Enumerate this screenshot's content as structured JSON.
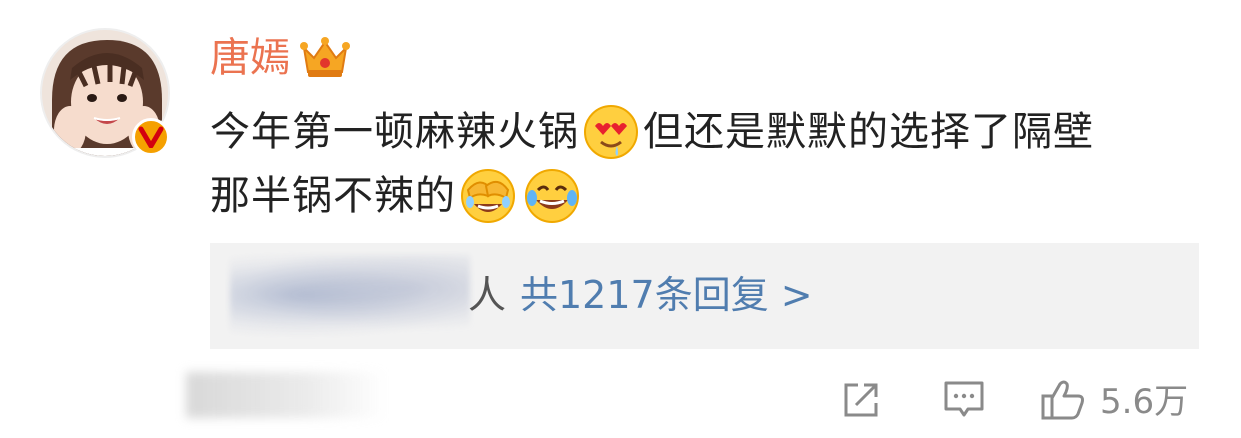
{
  "post": {
    "username": "唐嫣",
    "content": {
      "line1_text_a": "今年第一顿麻辣火锅",
      "line1_text_b": "但还是默默的选择了隔壁",
      "line2_text": "那半锅不辣的"
    },
    "emojis": [
      "heart-eyes-drool-emoji",
      "facepalm-laugh-emoji",
      "tears-of-joy-emoji"
    ]
  },
  "replies": {
    "people_suffix": "人",
    "link_text": "共1217条回复 >"
  },
  "actions": {
    "like_count": "5.6万"
  },
  "icons": {
    "verified": "verified-v-icon",
    "crown": "crown-badge-icon",
    "repost": "repost-icon",
    "comment": "comment-icon",
    "like": "thumbs-up-icon"
  },
  "colors": {
    "username": "#eb7350",
    "link": "#507daf",
    "verified": "#f5a000",
    "reply_bg": "#f2f2f2",
    "icon_gray": "#8a8a8a"
  }
}
